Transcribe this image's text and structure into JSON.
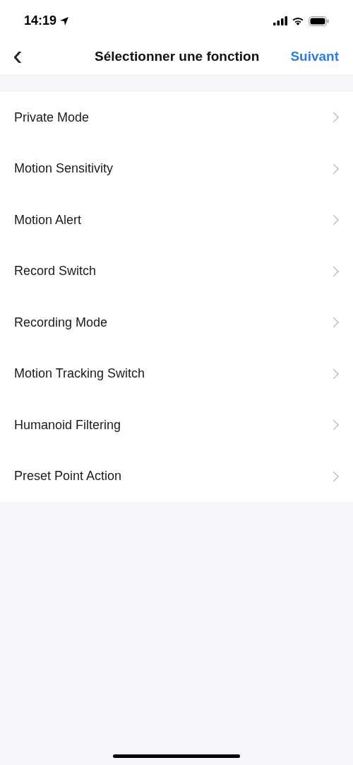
{
  "status_bar": {
    "time": "14:19"
  },
  "nav": {
    "back": "‹",
    "title": "Sélectionner une fonction",
    "action": "Suivant"
  },
  "items": [
    {
      "label": "Private Mode"
    },
    {
      "label": "Motion Sensitivity"
    },
    {
      "label": "Motion Alert"
    },
    {
      "label": "Record Switch"
    },
    {
      "label": "Recording Mode"
    },
    {
      "label": "Motion Tracking Switch"
    },
    {
      "label": "Humanoid Filtering"
    },
    {
      "label": "Preset Point Action"
    }
  ]
}
